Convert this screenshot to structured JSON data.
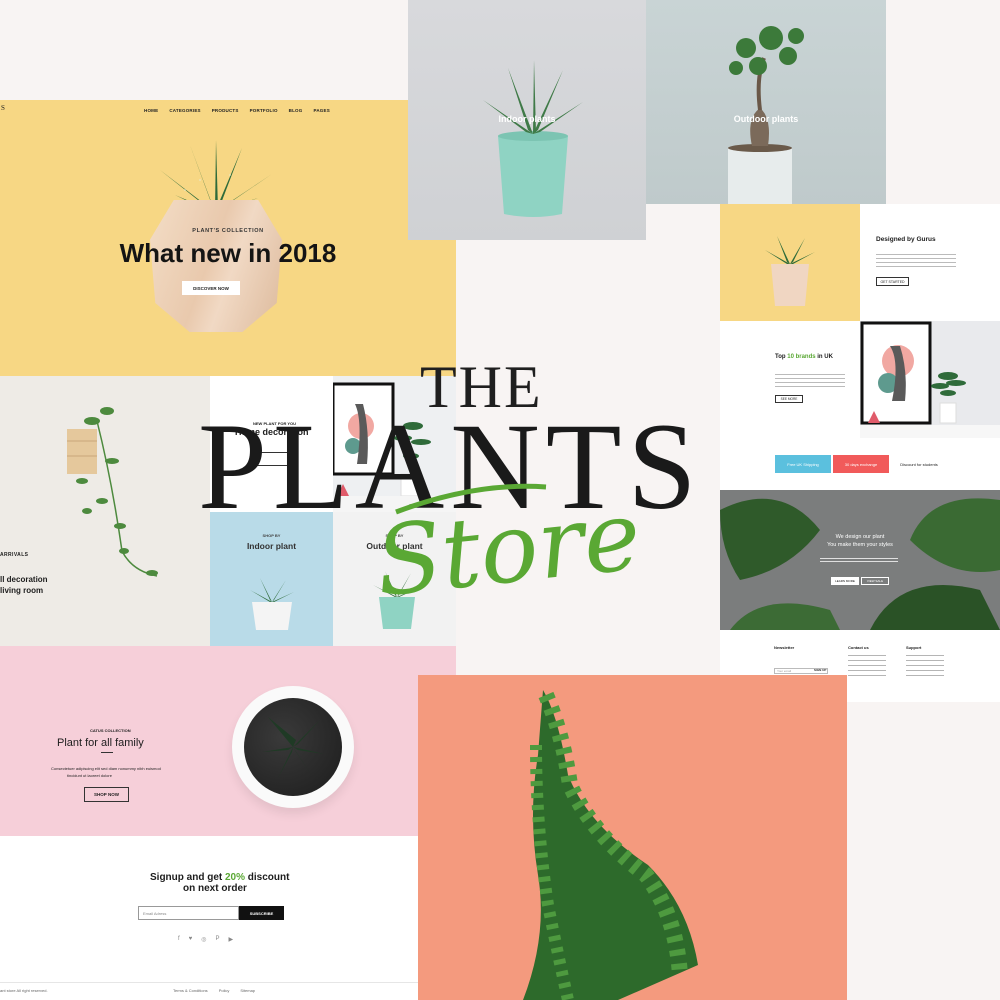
{
  "brand": {
    "the": "THE",
    "plants": "PLANTS",
    "store": "Store",
    "accent_color": "#5aa834"
  },
  "hero": {
    "logo_fragment": "S",
    "nav": [
      "HOME",
      "CATEGORIES",
      "PRODUCTS",
      "PORTFOLIO",
      "BLOG",
      "PAGES"
    ],
    "collection": "PLANT'S COLLECTION",
    "title": "What new in 2018",
    "button": "DISCOVER NOW",
    "bg_color": "#f7d784"
  },
  "categories_top": {
    "indoor": "Indoor plants",
    "outdoor": "Outdoor plants"
  },
  "designed": {
    "heading": "Designed by Gurus",
    "button": "GET STARTED"
  },
  "top_brands": {
    "heading_prefix": "Top",
    "heading_accent": "10 brands",
    "heading_suffix": "in UK",
    "button": "SEE MORE"
  },
  "features": [
    {
      "label": "Free UK Shipping",
      "color": "#5bc0de"
    },
    {
      "label": "30 days exchange",
      "color": "#f15a5a"
    },
    {
      "label": "Discount for students",
      "color": "#ffffff"
    }
  ],
  "monstera": {
    "line1": "We design our plant",
    "line2": "You make them your styles",
    "button1": "LEARN MORE",
    "button2": "VIEW SALE"
  },
  "footer_right": {
    "newsletter": "Newsletter",
    "contact": "Contact us",
    "support": "Support",
    "email_placeholder": "Your email",
    "email_button": "SIGN UP"
  },
  "wall": {
    "arrivals": "ARRIVALS",
    "line1": "ll decoration",
    "line2": "living room"
  },
  "home_decoration": {
    "small": "NEW PLANT FOR YOU",
    "heading": "Home decoration"
  },
  "indoor_mid": {
    "small": "SHOP BY",
    "heading": "Indoor plant"
  },
  "outdoor_mid": {
    "small": "SHOP BY",
    "heading": "Outdoor plant"
  },
  "pink": {
    "small": "CATUS COLLECTION",
    "heading": "Plant for all family",
    "p1": "Consectetuer adipiscing elit sed diam nonummy nibh euismod",
    "p2": "tincidunt ut laoreet dolore",
    "button": "SHOP NOW",
    "bg_color": "#f6cfd9"
  },
  "signup": {
    "line1_prefix": "Signup and get",
    "line1_accent": "20%",
    "line1_suffix": "discount",
    "line2": "on next order",
    "placeholder": "Email Adress",
    "button": "SUBSCRIBE",
    "social_icons": [
      "facebook-icon",
      "twitter-icon",
      "instagram-icon",
      "pinterest-icon",
      "youtube-icon"
    ],
    "copyright": "ant store All right reserved.",
    "links": [
      "Terms & Conditions",
      "Policy",
      "Sitemap"
    ]
  }
}
